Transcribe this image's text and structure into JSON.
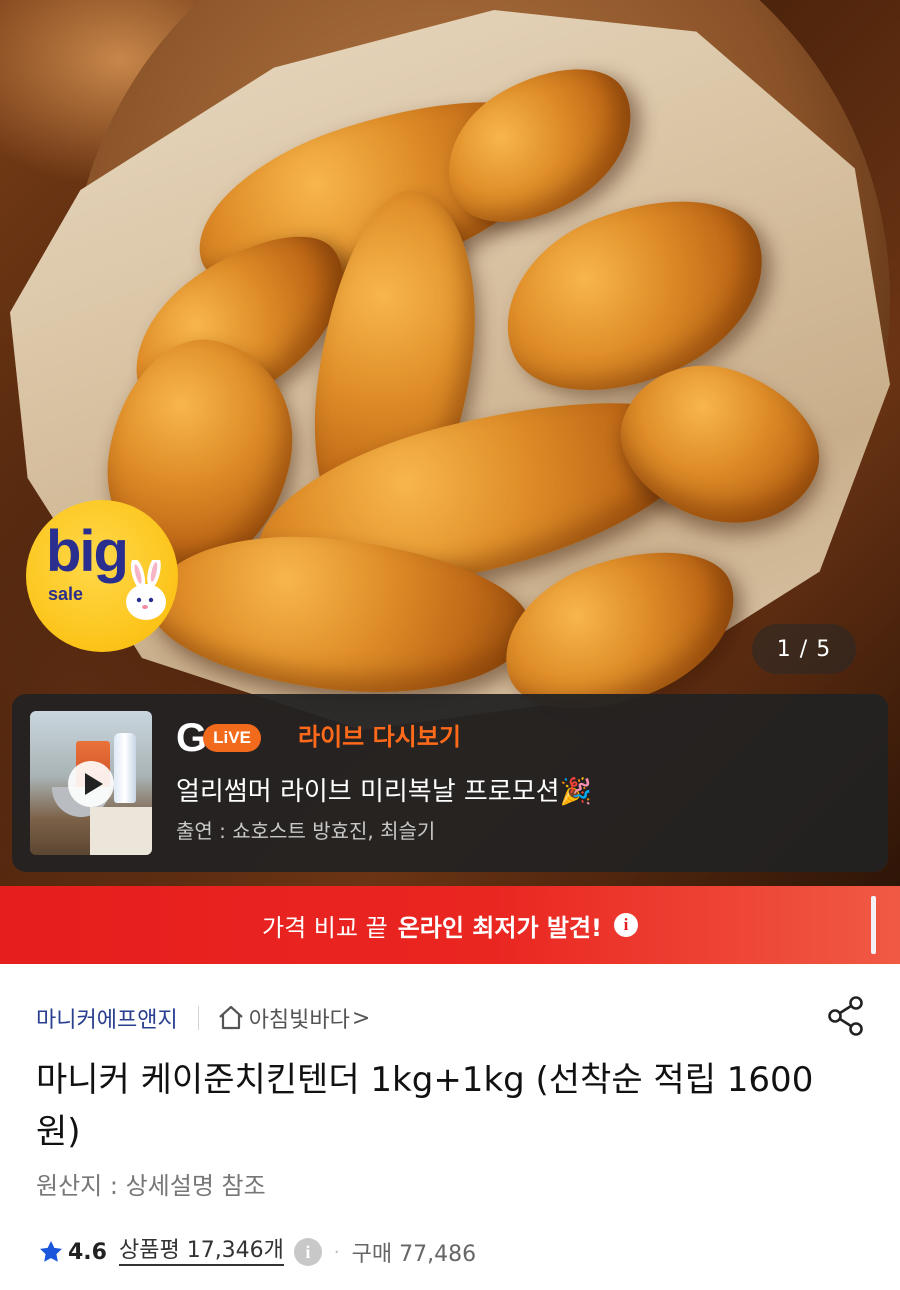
{
  "hero": {
    "image_alt": "",
    "badge": {
      "big": "big",
      "sale": "sale"
    },
    "counter": "1 / 5"
  },
  "live": {
    "logo_g": "G",
    "logo_live": "LiVE",
    "replay_label": "라이브 다시보기",
    "title": "얼리썸머 라이브 미리복날 프로모션🎉",
    "cast": "출연 : 쇼호스트 방효진, 최슬기"
  },
  "price_banner": {
    "text_normal": "가격 비교 끝",
    "text_bold": "온라인 최저가 발견!",
    "info": "i"
  },
  "product": {
    "brand": "마니커에프앤지",
    "store": "아침빛바다",
    "store_chevron": ">",
    "title": "마니커 케이준치킨텐더 1kg+1kg (선착순 적립 1600원)",
    "origin": "원산지 : 상세설명 참조",
    "rating": "4.6",
    "reviews": "상품평 17,346개",
    "info": "i",
    "dot": "·",
    "purchases": "구매 77,486"
  },
  "colors": {
    "brand_link": "#2a3f8f",
    "banner_red": "#e61e1e",
    "live_orange": "#f26a1b",
    "star_blue": "#1a56db"
  },
  "icons": [
    "home-icon",
    "share-icon",
    "star-icon",
    "info-icon",
    "play-icon",
    "bunny-icon"
  ]
}
